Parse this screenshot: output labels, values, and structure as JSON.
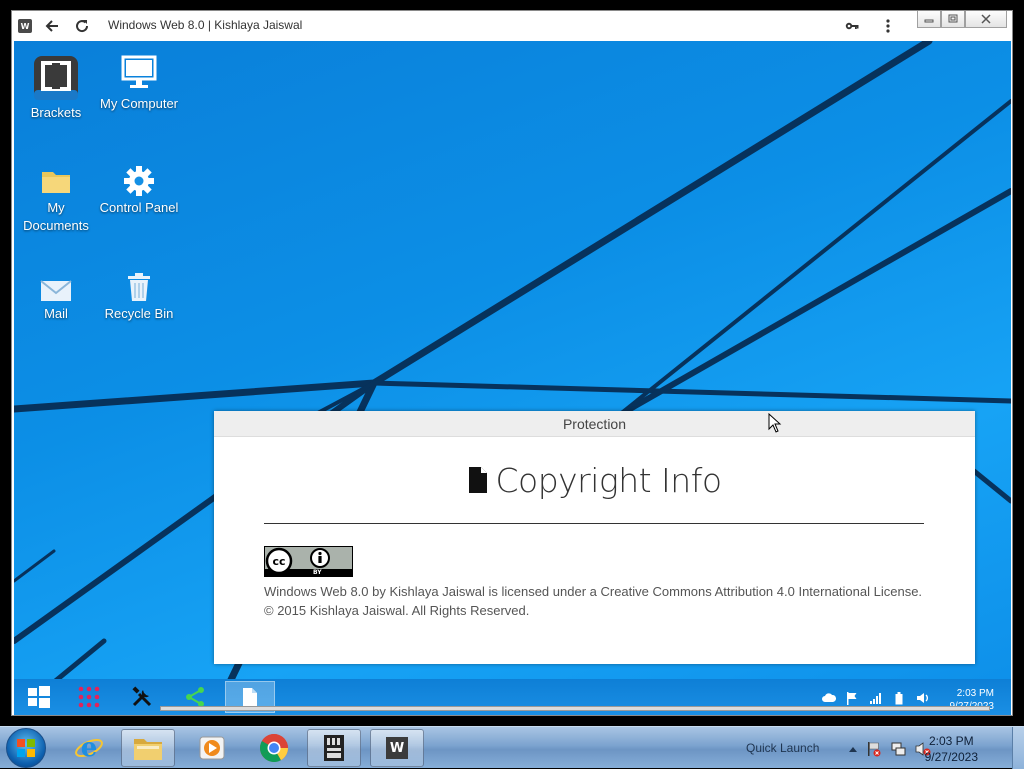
{
  "app": {
    "title": "Windows Web 8.0 | Kishlaya Jaiswal",
    "favicon_letter": "W",
    "back_icon": "arrow-left-icon",
    "reload_icon": "reload-icon",
    "key_icon": "key-icon",
    "menu_icon": "kebab-menu-icon"
  },
  "desktop": {
    "icons": [
      {
        "label": "Brackets",
        "icon": "brackets-icon"
      },
      {
        "label": "My Computer",
        "icon": "monitor-icon"
      },
      {
        "label": "My Documents",
        "icon": "folder-icon"
      },
      {
        "label": "Control Panel",
        "icon": "gear-icon"
      },
      {
        "label": "Mail",
        "icon": "envelope-icon"
      },
      {
        "label": "Recycle Bin",
        "icon": "trash-icon"
      }
    ]
  },
  "dialog": {
    "header": "Protection",
    "heading": "Copyright Info",
    "heading_icon": "document-icon",
    "badge_text": "BY",
    "license_line1": "Windows Web 8.0 by Kishlaya Jaiswal is licensed under a Creative Commons Attribution 4.0 International License.",
    "license_line2": "© 2015 Kishlaya Jaiswal. All Rights Reserved."
  },
  "inner_taskbar": {
    "buttons": [
      "windows-logo-icon",
      "apps-grid-icon",
      "tools-icon",
      "share-icon",
      "document-icon"
    ],
    "time": "2:03 PM",
    "date": "9/27/2023"
  },
  "host_taskbar": {
    "quick_launch": "Quick Launch",
    "time": "2:03 PM",
    "date": "9/27/2023",
    "colors": {
      "accent": "#0c8fe6"
    }
  }
}
